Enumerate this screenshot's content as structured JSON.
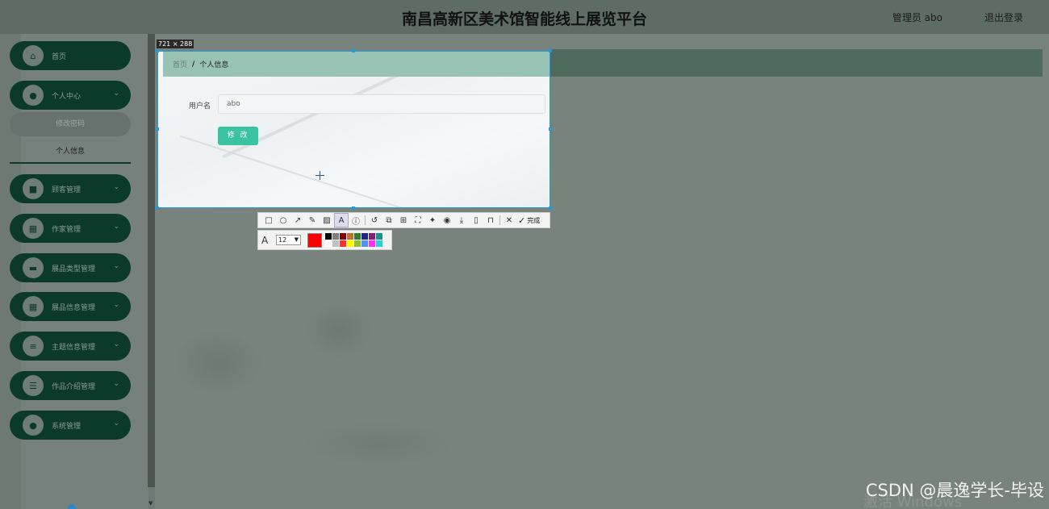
{
  "header": {
    "title": "南昌高新区美术馆智能线上展览平台",
    "user": "管理员 abo",
    "logout": "退出登录"
  },
  "sidebar": {
    "items": [
      {
        "label": "首页",
        "icon": "home-icon",
        "glyph": "⌂",
        "chevron": ""
      },
      {
        "label": "个人中心",
        "icon": "user-icon",
        "glyph": "●",
        "chevron": "⌄"
      },
      {
        "label": "顾客管理",
        "icon": "customer-icon",
        "glyph": "■",
        "chevron": "⌄"
      },
      {
        "label": "作家管理",
        "icon": "grid-icon",
        "glyph": "▦",
        "chevron": "⌄"
      },
      {
        "label": "展品类型管理",
        "icon": "box-icon",
        "glyph": "▬",
        "chevron": "⌄"
      },
      {
        "label": "展品信息管理",
        "icon": "grid-icon",
        "glyph": "▦",
        "chevron": "⌄"
      },
      {
        "label": "主题信息管理",
        "icon": "list-icon",
        "glyph": "≡",
        "chevron": "⌄"
      },
      {
        "label": "作品介绍管理",
        "icon": "menu-icon",
        "glyph": "☰",
        "chevron": "⌄"
      },
      {
        "label": "系统管理",
        "icon": "user-icon",
        "glyph": "●",
        "chevron": "⌄"
      }
    ],
    "submenu": [
      "修改密码",
      "个人信息"
    ]
  },
  "capture": {
    "size_label": "721 × 288"
  },
  "content": {
    "breadcrumb_home": "首页",
    "breadcrumb_sep": "/",
    "breadcrumb_current": "个人信息",
    "username_label": "用户名",
    "username_value": "abo",
    "submit_label": "修 改"
  },
  "toolbar": {
    "tools": [
      {
        "name": "rectangle-tool-icon",
        "glyph": "□"
      },
      {
        "name": "ellipse-tool-icon",
        "glyph": "○"
      },
      {
        "name": "arrow-tool-icon",
        "glyph": "↗"
      },
      {
        "name": "pencil-tool-icon",
        "glyph": "✎"
      },
      {
        "name": "mosaic-tool-icon",
        "glyph": "▨"
      },
      {
        "name": "text-tool-icon",
        "glyph": "A",
        "active": true
      },
      {
        "name": "number-tool-icon",
        "glyph": "ⓘ"
      },
      {
        "sep": true
      },
      {
        "name": "undo-icon",
        "glyph": "↺"
      },
      {
        "name": "save-crop-icon",
        "glyph": "⧉"
      },
      {
        "name": "ocr-icon",
        "glyph": "⊞"
      },
      {
        "name": "fullscreen-icon",
        "glyph": "⛶"
      },
      {
        "name": "pin-icon",
        "glyph": "✦"
      },
      {
        "name": "record-icon",
        "glyph": "◉"
      },
      {
        "name": "download-icon",
        "glyph": "⤓"
      },
      {
        "name": "phone-icon",
        "glyph": "▯"
      },
      {
        "name": "bookmark-icon",
        "glyph": "⊓"
      },
      {
        "sep": true
      },
      {
        "name": "close-icon",
        "glyph": "✕"
      }
    ],
    "done_label": "完成",
    "font_size": "12",
    "current_color": "#ff0000",
    "palette": [
      "#000000",
      "#808080",
      "#800000",
      "#c07030",
      "#2f7f2f",
      "#23238f",
      "#7f1f7f",
      "#1f8f8f",
      "#ffffff",
      "#c0c0c0",
      "#ff3030",
      "#ffff00",
      "#90c030",
      "#4f8fff",
      "#ff30ff",
      "#30d0d0"
    ]
  },
  "watermarks": {
    "csdn": "CSDN @晨逸学长-毕设",
    "windows": "激活 Windows"
  }
}
